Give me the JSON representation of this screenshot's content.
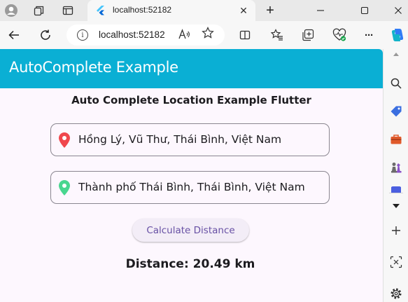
{
  "browser": {
    "tab_title": "localhost:52182",
    "url": "localhost:52182",
    "close_glyph": "✕",
    "new_tab_glyph": "+",
    "more_glyph": "···"
  },
  "app": {
    "title": "AutoComplete Example",
    "heading": "Auto Complete Location Example Flutter",
    "origin_value": "Hồng Lý, Vũ Thư, Thái Bình, Việt Nam",
    "destination_value": "Thành phố Thái Bình, Thái Bình, Việt Nam",
    "button_label": "Calculate Distance",
    "distance_text": "Distance: 20.49 km"
  },
  "colors": {
    "appbar": "#0aafd4",
    "origin_pin": "#f0474d",
    "destination_pin": "#49d68f",
    "button_text": "#6750a4"
  }
}
